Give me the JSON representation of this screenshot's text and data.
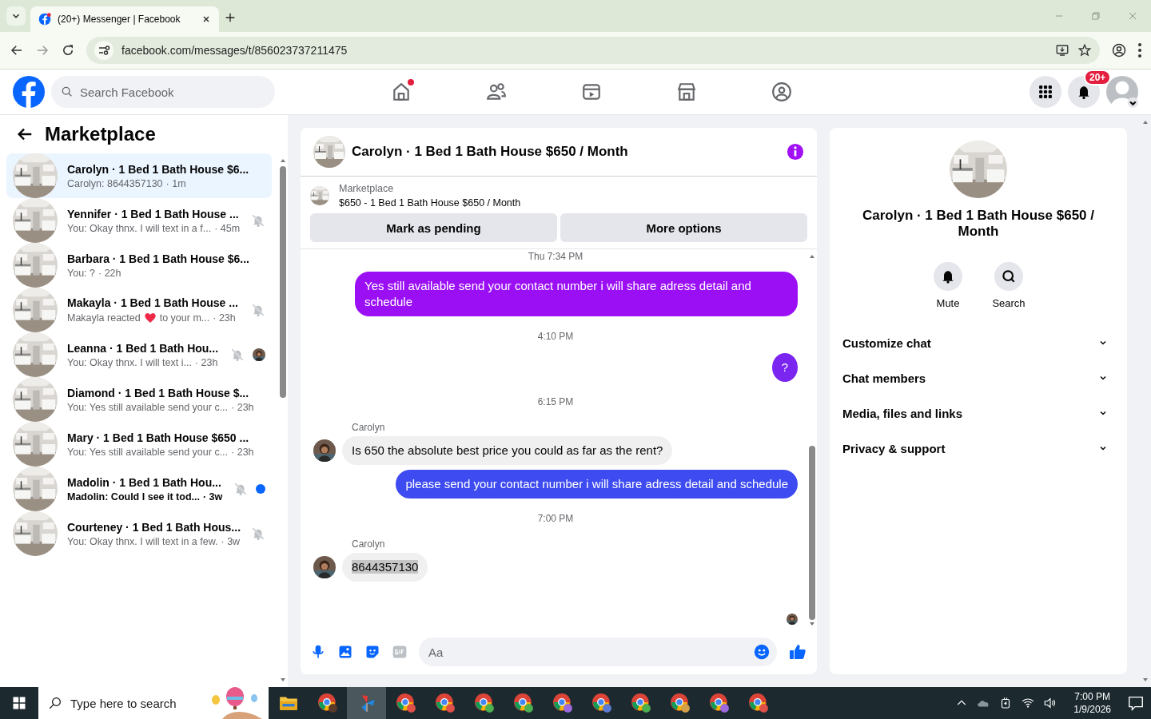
{
  "browser": {
    "tab_title": "(20+) Messenger | Facebook",
    "url": "facebook.com/messages/t/856023737211475"
  },
  "header": {
    "search_placeholder": "Search Facebook",
    "badge": "20+",
    "nav": [
      {
        "kind": "home",
        "dot": true
      },
      {
        "kind": "friends",
        "dot": false
      },
      {
        "kind": "video",
        "dot": false
      },
      {
        "kind": "marketplace",
        "dot": false
      },
      {
        "kind": "groups",
        "dot": false
      }
    ]
  },
  "sidebar": {
    "title": "Marketplace",
    "conversations": [
      {
        "name": "Carolyn · 1 Bed 1 Bath House $6...",
        "preview": "Carolyn: 8644357130",
        "time": "· 1m",
        "selected": true,
        "muted": false,
        "unread": false,
        "seen": false
      },
      {
        "name": "Yennifer · 1 Bed 1 Bath House ...",
        "preview": "You: Okay thnx. I will text in a f...",
        "time": "· 45m",
        "selected": false,
        "muted": true,
        "unread": false,
        "seen": false
      },
      {
        "name": "Barbara · 1 Bed 1 Bath House $6...",
        "preview": "You: ?",
        "time": "· 22h",
        "selected": false,
        "muted": false,
        "unread": false,
        "seen": false
      },
      {
        "name": "Makayla · 1 Bed 1 Bath House ...",
        "preview": "Makayla reacted",
        "reaction": true,
        "preview_tail": "to your m...",
        "time": "· 23h",
        "selected": false,
        "muted": true,
        "unread": false,
        "seen": false
      },
      {
        "name": "Leanna · 1 Bed 1 Bath Hou...",
        "preview": "You: Okay thnx. I will text i...",
        "time": "· 23h",
        "selected": false,
        "muted": true,
        "unread": false,
        "seen": true
      },
      {
        "name": "Diamond · 1 Bed 1 Bath House $...",
        "preview": "You: Yes still available send your c...",
        "time": "· 23h",
        "selected": false,
        "muted": false,
        "unread": false,
        "seen": false
      },
      {
        "name": "Mary · 1 Bed 1 Bath House $650 ...",
        "preview": "You: Yes still available send your c...",
        "time": "· 23h",
        "selected": false,
        "muted": false,
        "unread": false,
        "seen": false
      },
      {
        "name": "Madolin · 1 Bed 1 Bath Hou...",
        "preview": "Madolin: Could I see it tod...",
        "time": "· 3w",
        "selected": false,
        "muted": true,
        "unread": true,
        "seen": false
      },
      {
        "name": "Courteney · 1 Bed 1 Bath Hous...",
        "preview": "You: Okay thnx. I will text in a few.",
        "time": "· 3w",
        "selected": false,
        "muted": true,
        "unread": false,
        "seen": false
      }
    ]
  },
  "chat": {
    "title": "Carolyn · 1 Bed 1 Bath House $650 / Month",
    "listing": {
      "label": "Marketplace",
      "text": "$650 - 1 Bed 1 Bath House $650 / Month"
    },
    "actions": [
      "Mark as pending",
      "More options"
    ],
    "messages": [
      {
        "kind": "time",
        "text": "Thu 7:34 PM"
      },
      {
        "kind": "outgoing",
        "text": "Yes still available send your contact number i will share adress detail and schedule",
        "color": "#9b0ff5"
      },
      {
        "kind": "time",
        "text": "4:10 PM"
      },
      {
        "kind": "outgoing",
        "text": "?",
        "color": "#7a25f0"
      },
      {
        "kind": "time",
        "text": "6:15 PM"
      },
      {
        "kind": "incoming",
        "sender": "Carolyn",
        "text": "Is 650 the absolute best price you could as far as the rent?",
        "highlighted": false
      },
      {
        "kind": "outgoing",
        "text": "please send your contact number i will share adress detail and schedule",
        "color": "#3d4bf0"
      },
      {
        "kind": "time",
        "text": "7:00 PM"
      },
      {
        "kind": "incoming",
        "sender": "Carolyn",
        "text": "8644357130",
        "highlighted": true
      }
    ],
    "composer_placeholder": "Aa"
  },
  "details": {
    "title": "Carolyn · 1 Bed 1 Bath House $650 / Month",
    "actions": [
      {
        "kind": "mute",
        "label": "Mute"
      },
      {
        "kind": "search",
        "label": "Search"
      }
    ],
    "sections": [
      {
        "label": "Customize chat",
        "expanded": false
      },
      {
        "label": "Chat members",
        "expanded": false
      },
      {
        "label": "Media, files and links",
        "expanded": false
      },
      {
        "label": "Privacy & support",
        "expanded": false
      }
    ]
  },
  "taskbar": {
    "search_placeholder": "Type here to search",
    "time": "7:00 PM",
    "date": "1/9/2026",
    "apps": [
      {
        "kind": "explorer",
        "selected": false
      },
      {
        "kind": "chrome",
        "color": "#5a3a2a",
        "selected": false
      },
      {
        "kind": "tool",
        "selected": true
      },
      {
        "kind": "chrome",
        "color": "#e0504a",
        "selected": false
      },
      {
        "kind": "chrome",
        "color": "#e0504a",
        "selected": false
      },
      {
        "kind": "chrome",
        "color": "#4caf50",
        "selected": false
      },
      {
        "kind": "chrome",
        "color": "#4caf50",
        "selected": false
      },
      {
        "kind": "chrome",
        "color": "#9c6ade",
        "selected": false
      },
      {
        "kind": "chrome",
        "color": "#5b7bd5",
        "selected": false
      },
      {
        "kind": "chrome",
        "color": "#4caf50",
        "selected": false
      },
      {
        "kind": "chrome",
        "color": "#d4a04a",
        "selected": false
      },
      {
        "kind": "chrome",
        "color": "#9c6ade",
        "selected": false
      },
      {
        "kind": "chrome",
        "color": "#e0504a",
        "selected": false
      }
    ]
  }
}
